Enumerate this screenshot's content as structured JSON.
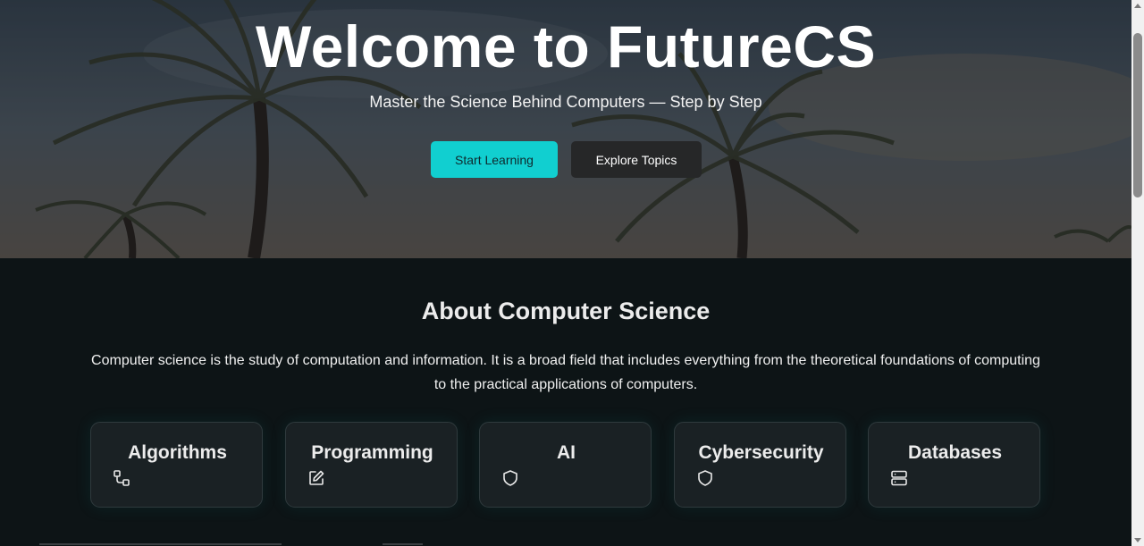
{
  "hero": {
    "title": "Welcome to FutureCS",
    "subtitle": "Master the Science Behind Computers — Step by Step",
    "primary_button": "Start Learning",
    "secondary_button": "Explore Topics"
  },
  "about": {
    "title": "About Computer Science",
    "description": "Computer science is the study of computation and information. It is a broad field that includes everything from the theoretical foundations of computing to the practical applications of computers."
  },
  "topics": [
    {
      "label": "Algorithms",
      "icon": "flow-icon"
    },
    {
      "label": "Programming",
      "icon": "edit-icon"
    },
    {
      "label": "AI",
      "icon": "shield-icon"
    },
    {
      "label": "Cybersecurity",
      "icon": "shield-icon"
    },
    {
      "label": "Databases",
      "icon": "server-icon"
    }
  ],
  "colors": {
    "accent": "#11cfd0",
    "dark_button": "#262728",
    "section_bg": "#0d1416",
    "card_bg": "#1a2124"
  }
}
